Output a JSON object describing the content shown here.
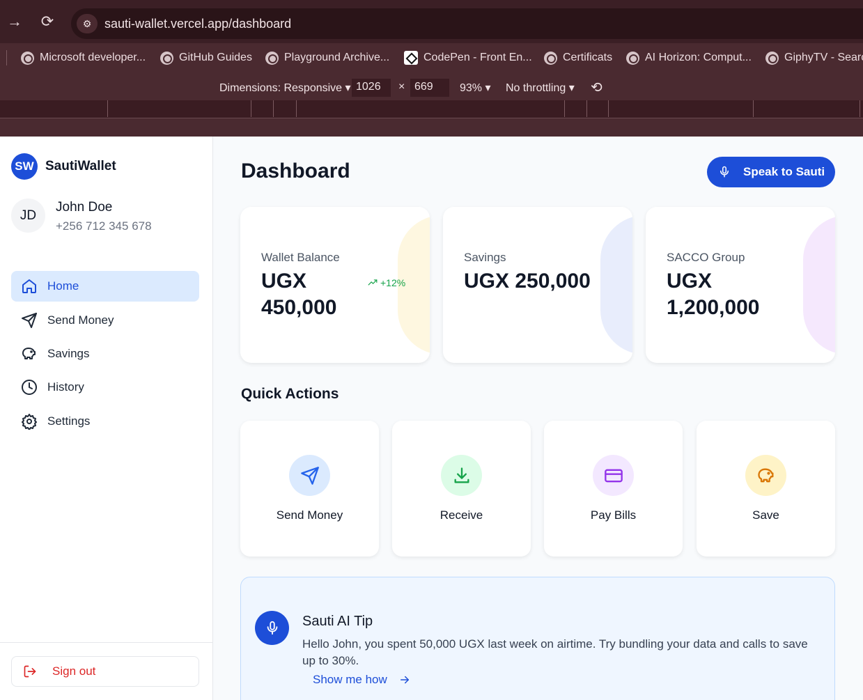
{
  "browser": {
    "url": "sauti-wallet.vercel.app/dashboard",
    "bookmarks": [
      {
        "label": "Microsoft developer...",
        "icon": "globe-icon"
      },
      {
        "label": "GitHub Guides",
        "icon": "globe-icon"
      },
      {
        "label": "Playground Archive...",
        "icon": "globe-icon"
      },
      {
        "label": "CodePen - Front En...",
        "icon": "codepen-icon"
      },
      {
        "label": "Certificats",
        "icon": "globe-icon"
      },
      {
        "label": "AI Horizon: Comput...",
        "icon": "globe-icon"
      },
      {
        "label": "GiphyTV - Searc",
        "icon": "globe-icon"
      }
    ],
    "devtools": {
      "dimensions_label": "Dimensions: Responsive",
      "width": "1026",
      "times": "×",
      "height": "669",
      "zoom": "93%",
      "throttling": "No throttling"
    }
  },
  "sidebar": {
    "logo": "SW",
    "brand": "SautiWallet",
    "user": {
      "initials": "JD",
      "name": "John Doe",
      "phone": "+256 712 345 678"
    },
    "nav": [
      {
        "label": "Home",
        "icon": "home-icon",
        "active": true
      },
      {
        "label": "Send Money",
        "icon": "send-icon",
        "active": false
      },
      {
        "label": "Savings",
        "icon": "piggy-bank-icon",
        "active": false
      },
      {
        "label": "History",
        "icon": "clock-icon",
        "active": false
      },
      {
        "label": "Settings",
        "icon": "gear-icon",
        "active": false
      }
    ],
    "signout": "Sign out"
  },
  "main": {
    "title": "Dashboard",
    "speak_button": "Speak to Sauti",
    "cards": [
      {
        "label": "Wallet Balance",
        "value_line1": "UGX",
        "value_line2": "450,000",
        "trend": "+12%",
        "blob_color": "#fef7e0"
      },
      {
        "label": "Savings",
        "value_line1": "UGX 250,000",
        "value_line2": "",
        "blob_color": "#e8edfc"
      },
      {
        "label": "SACCO Group",
        "value_line1": "UGX",
        "value_line2": "1,200,000",
        "blob_color": "#f5e8fd"
      }
    ],
    "quick_actions_title": "Quick Actions",
    "quick_actions": [
      {
        "label": "Send Money",
        "icon": "send-icon",
        "bg": "#dbeafe",
        "fg": "#2563eb"
      },
      {
        "label": "Receive",
        "icon": "download-icon",
        "bg": "#dcfce7",
        "fg": "#16a34a"
      },
      {
        "label": "Pay Bills",
        "icon": "credit-card-icon",
        "bg": "#f3e8ff",
        "fg": "#9333ea"
      },
      {
        "label": "Save",
        "icon": "piggy-bank-icon",
        "bg": "#fef3c7",
        "fg": "#d97706"
      }
    ],
    "tip": {
      "title": "Sauti AI Tip",
      "text": "Hello John, you spent 50,000 UGX last week on airtime. Try bundling your data and calls to save up to 30%.",
      "link": "Show me how"
    }
  },
  "colors": {
    "accent": "#1d4ed8",
    "danger": "#dc2626",
    "success": "#16a34a"
  }
}
